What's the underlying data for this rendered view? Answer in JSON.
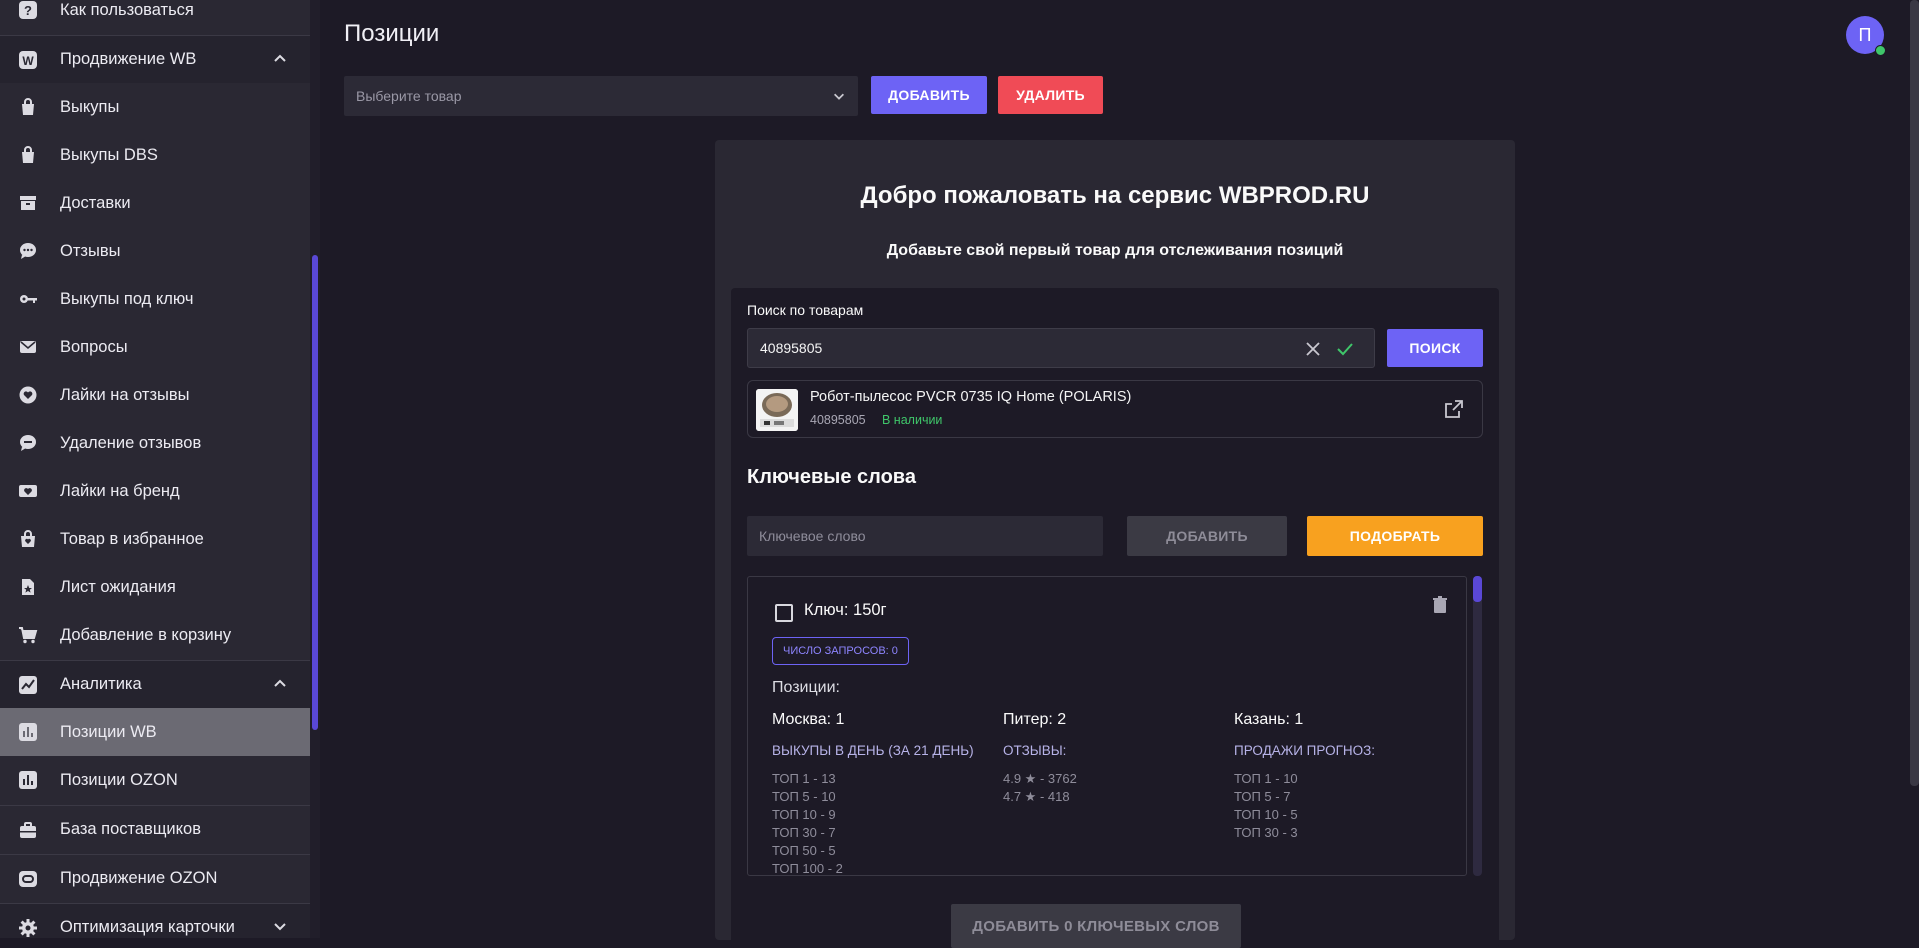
{
  "sidebar": {
    "items": [
      {
        "label": "Как пользоваться",
        "icon": "question-icon"
      },
      {
        "label": "Продвижение WB",
        "icon": "wb-logo-icon",
        "group": true,
        "expanded": true
      },
      {
        "label": "Выкупы",
        "icon": "shopping-bag-icon"
      },
      {
        "label": "Выкупы DBS",
        "icon": "shopping-bag-icon"
      },
      {
        "label": "Доставки",
        "icon": "archive-box-icon"
      },
      {
        "label": "Отзывы",
        "icon": "chat-bubble-icon"
      },
      {
        "label": "Выкупы под ключ",
        "icon": "key-icon"
      },
      {
        "label": "Вопросы",
        "icon": "envelope-icon"
      },
      {
        "label": "Лайки на отзывы",
        "icon": "heart-circle-icon"
      },
      {
        "label": "Удаление отзывов",
        "icon": "chat-delete-icon"
      },
      {
        "label": "Лайки на бренд",
        "icon": "heart-ticket-icon"
      },
      {
        "label": "Товар в избранное",
        "icon": "bag-heart-icon"
      },
      {
        "label": "Лист ожидания",
        "icon": "star-file-icon"
      },
      {
        "label": "Добавление в корзину",
        "icon": "cart-icon"
      },
      {
        "label": "Аналитика",
        "icon": "chart-icon",
        "group": true,
        "expanded": true
      },
      {
        "label": "Позиции WB",
        "icon": "poll-icon",
        "active": true
      },
      {
        "label": "Позиции OZON",
        "icon": "poll-icon"
      },
      {
        "label": "База поставщиков",
        "icon": "briefcase-icon"
      },
      {
        "label": "Продвижение OZON",
        "icon": "ozon-logo-icon"
      },
      {
        "label": "Оптимизация карточки",
        "icon": "gear-icon",
        "group": true,
        "expanded": false
      }
    ]
  },
  "header": {
    "title": "Позиции",
    "select_placeholder": "Выберите товар",
    "add_label": "ДОБАВИТЬ",
    "delete_label": "УДАЛИТЬ",
    "avatar_letter": "П"
  },
  "card": {
    "welcome": "Добро пожаловать на сервис WBPROD.RU",
    "subtitle": "Добавьте свой первый товар для отслеживания позиций",
    "search": {
      "label": "Поиск по товарам",
      "value": "40895805",
      "button": "ПОИСК"
    },
    "product": {
      "name": "Робот-пылесос PVCR 0735 IQ Home (POLARIS)",
      "id": "40895805",
      "stock": "В наличии"
    },
    "keywords": {
      "title": "Ключевые слова",
      "placeholder": "Ключевое слово",
      "add_label": "ДОБАВИТЬ",
      "pick_label": "ПОДОБРАТЬ",
      "bulk_add_label": "ДОБАВИТЬ 0 КЛЮЧЕВЫХ СЛОВ",
      "item": {
        "name": "Ключ: 150г",
        "badge": "ЧИСЛО ЗАПРОСОВ: 0",
        "positions_label": "Позиции:",
        "columns": [
          {
            "head": "Москва: 1",
            "sub": "ВЫКУПЫ В ДЕНЬ (ЗА 21 ДЕНЬ)",
            "lines": [
              "ТОП 1 - 13",
              "ТОП 5 - 10",
              "ТОП 10 - 9",
              "ТОП 30 - 7",
              "ТОП 50 - 5",
              "ТОП 100 - 2"
            ]
          },
          {
            "head": "Питер: 2",
            "sub": "ОТЗЫВЫ:",
            "lines": [
              "4.9 ★ - 3762",
              "4.7 ★ - 418"
            ]
          },
          {
            "head": "Казань: 1",
            "sub": "ПРОДАЖИ ПРОГНОЗ:",
            "lines": [
              "ТОП 1 - 10",
              "ТОП 5 - 7",
              "ТОП 10 - 5",
              "ТОП 30 - 3"
            ]
          }
        ]
      }
    }
  },
  "colors": {
    "accent": "#6d63f5",
    "danger": "#f04b56",
    "warning": "#f8a11f",
    "success": "#3fc66a"
  }
}
